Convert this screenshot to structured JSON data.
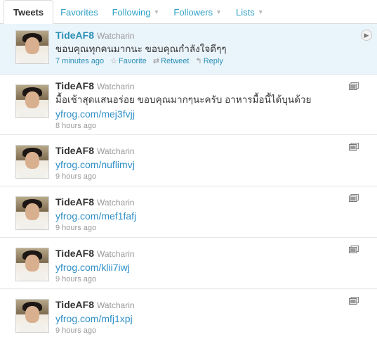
{
  "tabs": [
    {
      "label": "Tweets"
    },
    {
      "label": "Favorites"
    },
    {
      "label": "Following"
    },
    {
      "label": "Followers"
    },
    {
      "label": "Lists"
    }
  ],
  "actions": {
    "favorite": "Favorite",
    "retweet": "Retweet",
    "reply": "Reply"
  },
  "tweets": [
    {
      "name": "TideAF8",
      "realname": "Watcharin",
      "text": "ขอบคุณทุกคนมากนะ ขอบคุณกำลังใจดีๆๆ",
      "time": "7 minutes ago"
    },
    {
      "name": "TideAF8",
      "realname": "Watcharin",
      "text": "มื้อเช้าสุดแสนอร่อย ขอบคุณมากๆนะครับ อาหารมื้อนี้ได้บุนด้วย",
      "link": "yfrog.com/mej3fvjj",
      "time": "8 hours ago"
    },
    {
      "name": "TideAF8",
      "realname": "Watcharin",
      "link": "yfrog.com/nuflimvj",
      "time": "9 hours ago"
    },
    {
      "name": "TideAF8",
      "realname": "Watcharin",
      "link": "yfrog.com/mef1fafj",
      "time": "9 hours ago"
    },
    {
      "name": "TideAF8",
      "realname": "Watcharin",
      "link": "yfrog.com/klii7iwj",
      "time": "9 hours ago"
    },
    {
      "name": "TideAF8",
      "realname": "Watcharin",
      "link": "yfrog.com/mfj1xpj",
      "time": "9 hours ago"
    }
  ]
}
